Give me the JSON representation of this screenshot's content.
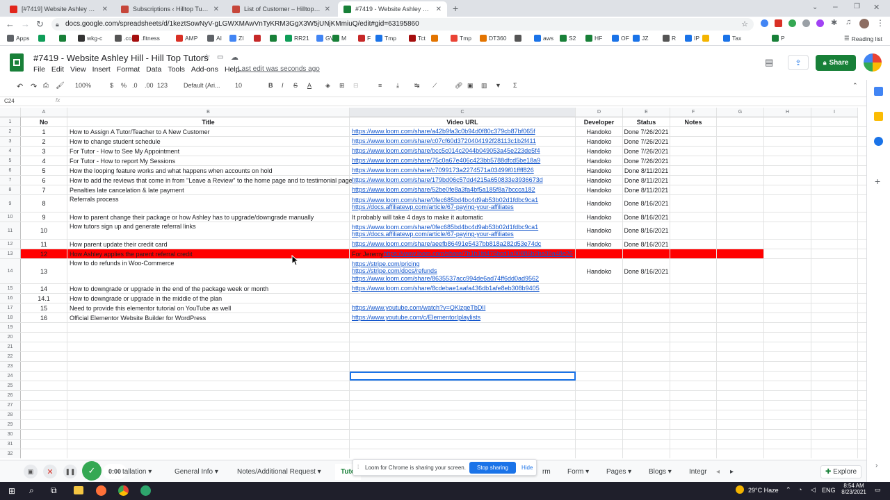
{
  "browser": {
    "tabs": [
      {
        "title": "[#7419] Website Ashley Hill - Hil",
        "color": "#e1251b"
      },
      {
        "title": "Subscriptions ‹ Hilltop Tutor — W",
        "color": "#c6463a"
      },
      {
        "title": "List of Customer – Hilltop Tutor",
        "color": "#c6463a"
      },
      {
        "title": "#7419 - Website Ashley Hill - Hil",
        "color": "#188038"
      }
    ],
    "url": "docs.google.com/spreadsheets/d/1keztSowNyV-gLGWXMAwVnTyKRM3GgX3W5jUNjKMmiuQ/edit#gid=63195860",
    "bookmarks": [
      "Apps",
      "",
      "",
      "wkg-c",
      ".com",
      ".fitness",
      "AMP",
      "AI",
      "ZI",
      "",
      "",
      "RR21",
      "GV",
      "M",
      "F",
      "Tmp",
      "Tct",
      "",
      "Tmp",
      "DT360",
      "",
      "aws",
      "S2",
      "HF",
      "OF",
      "JZ",
      "R",
      "IP",
      "",
      "Tax",
      "P"
    ],
    "reading_list": "Reading list"
  },
  "doc": {
    "title": "#7419 - Website Ashley Hill - Hill Top Tutors",
    "menus": [
      "File",
      "Edit",
      "View",
      "Insert",
      "Format",
      "Data",
      "Tools",
      "Add-ons",
      "Help"
    ],
    "last_edit": "Last edit was seconds ago",
    "share_label": "Share"
  },
  "toolbar": {
    "zoom": "100%",
    "currency": "$",
    "percent": "%",
    "dec1": ".0",
    "dec2": ".00",
    "numfmt": "123",
    "font": "Default (Ari...",
    "size": "10"
  },
  "formula": {
    "cell_ref": "C24",
    "fx": "fx"
  },
  "columns": [
    "A",
    "B",
    "C",
    "D",
    "E",
    "F",
    "G",
    "H",
    "I"
  ],
  "headers": {
    "no": "No",
    "title": "Title",
    "video_url": "Video URL",
    "developer": "Developer",
    "status": "Status",
    "notes": "Notes"
  },
  "rows": [
    {
      "n": "2",
      "no": "1",
      "title": "How to Assign A Tutor/Teacher to A New Customer",
      "urls": [
        "https://www.loom.com/share/a42b9fa3c0b94d0f80c379cb87bf065f"
      ],
      "dev": "Handoko",
      "status": "Done 7/26/2021"
    },
    {
      "n": "3",
      "no": "2",
      "title": "How to change student schedule",
      "urls": [
        "https://www.loom.com/share/c07cf60d3720404192f28113c1b2f411"
      ],
      "dev": "Handoko",
      "status": "Done 7/26/2021"
    },
    {
      "n": "4",
      "no": "3",
      "title": "For Tutor - How to See My Appointment",
      "urls": [
        "https://www.loom.com/share/bcc5c014c2044b049053a45e223de5f4"
      ],
      "dev": "Handoko",
      "status": "Done 7/26/2021"
    },
    {
      "n": "5",
      "no": "4",
      "title": "For Tutor - How to report My Sessions",
      "urls": [
        "https://www.loom.com/share/75c0a67e406c423bb5788dfcd5be18a9"
      ],
      "dev": "Handoko",
      "status": "Done 7/26/2021"
    },
    {
      "n": "6",
      "no": "5",
      "title": "How the looping feature works and what happens when accounts on hold",
      "urls": [
        "https://www.loom.com/share/c7099173a2274571a03499f01ffff826"
      ],
      "dev": "Handoko",
      "status": "Done 8/11/2021"
    },
    {
      "n": "7",
      "no": "6",
      "title": "How to add the reviews that come in from \"Leave a Review\" to the home page and to testimonial page",
      "urls": [
        "https://www.loom.com/share/179bd06c57dd4215a650833e3936673d"
      ],
      "dev": "Handoko",
      "status": "Done 8/11/2021"
    },
    {
      "n": "8",
      "no": "7",
      "title": "Penalties late cancelation & late payment",
      "urls": [
        "https://www.loom.com/share/52be0fe8a3fa4bf5a185f8a7bccca182"
      ],
      "dev": "Handoko",
      "status": "Done 8/11/2021"
    },
    {
      "n": "9",
      "no": "8",
      "title": "Referrals process",
      "urls": [
        "https://www.loom.com/share/0fec685bd4bc4d9ab53b02d1fdbc9ca1",
        "https://docs.affiliatewp.com/article/67-paying-your-affiliates"
      ],
      "dev": "Handoko",
      "status": "Done 8/16/2021"
    },
    {
      "n": "10",
      "no": "9",
      "title": "How to parent change their package or how Ashley has to upgrade/downgrade manually",
      "plain": "It probably will take 4 days to make it automatic",
      "urls": [],
      "dev": "Handoko",
      "status": "Done 8/16/2021"
    },
    {
      "n": "11",
      "no": "10",
      "title": "How tutors sign up and generate referral links",
      "urls": [
        "https://www.loom.com/share/0fec685bd4bc4d9ab53b02d1fdbc9ca1",
        "https://docs.affiliatewp.com/article/67-paying-your-affiliates"
      ],
      "dev": "Handoko",
      "status": "Done 8/16/2021"
    },
    {
      "n": "12",
      "no": "11",
      "title": "How parent update their credit card",
      "urls": [
        "https://www.loom.com/share/aeefb86491e5437bb818a282d53e74dc"
      ],
      "dev": "Handoko",
      "status": "Done 8/16/2021"
    },
    {
      "n": "13",
      "no": "12",
      "title": "How Ashley applies the parent referral credit",
      "plain": "For Jeremy",
      "urls": [
        "https://www.loom.com/share/7b1b1fd475bcd1a90886b2ba39a48e26"
      ],
      "dev": "",
      "status": "",
      "highlight": true
    },
    {
      "n": "14",
      "no": "13",
      "title": "How to do refunds in Woo-Commerce",
      "urls": [
        "https://stripe.com/pricing",
        "https://stripe.com/docs/refunds",
        "https://www.loom.com/share/8635537acc994de6ad74ff6dd0ad9562"
      ],
      "dev": "Handoko",
      "status": "Done 8/16/2021"
    },
    {
      "n": "15",
      "no": "14",
      "title": "How to downgrade or upgrade in the end of the package week or month",
      "urls": [
        "https://www.loom.com/share/8cdebae1aafa436db1afe8eb308b9405"
      ],
      "dev": "",
      "status": ""
    },
    {
      "n": "16",
      "no": "14.1",
      "title": "How to downgrade or upgrade in the middle of the plan",
      "urls": [],
      "dev": "",
      "status": ""
    },
    {
      "n": "17",
      "no": "15",
      "title": "Need to provide this elementor tutorial on YouTube as well",
      "urls": [
        "https://www.youtube.com/watch?v=QKlzgeTbDII"
      ],
      "dev": "",
      "status": ""
    },
    {
      "n": "18",
      "no": "16",
      "title": "Official Elementor Website Builder for WordPress",
      "urls": [
        "https://www.youtube.com/c/Elementor/playlists"
      ],
      "dev": "",
      "status": ""
    }
  ],
  "empty_rows": [
    "19",
    "20",
    "21",
    "22",
    "23",
    "24",
    "25",
    "26",
    "27",
    "28",
    "29",
    "30",
    "31",
    "32"
  ],
  "sheet_tabs": [
    "tallation",
    "General Info",
    "Notes/Additional Request",
    "Tuto",
    "rm",
    "Form",
    "Pages",
    "Blogs",
    "Integr"
  ],
  "explore_label": "Explore",
  "loom": {
    "message": "Loom for Chrome is sharing your screen.",
    "stop": "Stop sharing",
    "hide": "Hide",
    "timer": "0:00"
  },
  "taskbar": {
    "weather": "29°C Haze",
    "lang": "ENG",
    "time": "8:54 AM",
    "date": "8/23/2021"
  },
  "colors": {
    "highlight_red": "#ff0000",
    "share_green": "#188038",
    "link_blue": "#1155cc",
    "loom_blue": "#1a73e8"
  }
}
